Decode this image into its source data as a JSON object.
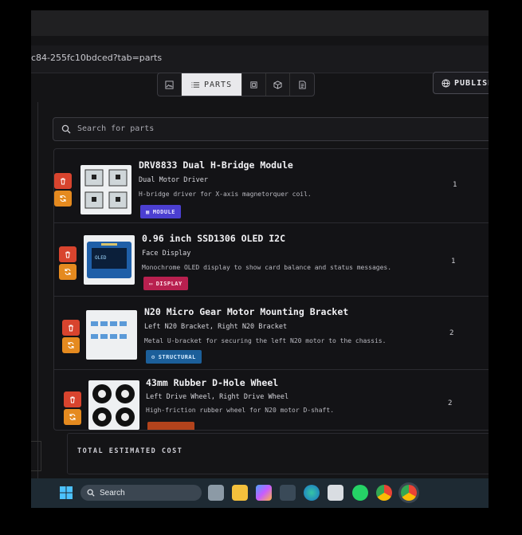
{
  "browser": {
    "url": "c84-255fc10bdced?tab=parts"
  },
  "toolbar": {
    "tabs": [
      {
        "icon": "image-icon",
        "label": ""
      },
      {
        "icon": "list-icon",
        "label": "PARTS"
      },
      {
        "icon": "chip-icon",
        "label": ""
      },
      {
        "icon": "cube-icon",
        "label": ""
      },
      {
        "icon": "document-icon",
        "label": ""
      }
    ],
    "publish_label": "PUBLISH"
  },
  "search": {
    "placeholder": "Search for parts"
  },
  "parts": [
    {
      "name": "DRV8833 Dual H-Bridge Module",
      "role": "Dual Motor Driver",
      "description": "H-bridge driver for X-axis magnetorquer coil.",
      "badge": "MODULE",
      "badge_color": "#4b3fd1",
      "quantity": "1"
    },
    {
      "name": "0.96 inch SSD1306 OLED I2C",
      "role": "Face Display",
      "description": "Monochrome OLED display to show card balance and status messages.",
      "badge": "DISPLAY",
      "badge_color": "#b8204f",
      "quantity": "1"
    },
    {
      "name": "N20 Micro Gear Motor Mounting Bracket",
      "role": "Left N20 Bracket, Right N20 Bracket",
      "description": "Metal U-bracket for securing the left N20 motor to the chassis.",
      "badge": "STRUCTURAL",
      "badge_color": "#1c5f9a",
      "quantity": "2"
    },
    {
      "name": "43mm Rubber D-Hole Wheel",
      "role": "Left Drive Wheel, Right Drive Wheel",
      "description": "High-friction rubber wheel for N20 motor D-shaft.",
      "badge": "",
      "badge_color": "#b2431c",
      "quantity": "2"
    }
  ],
  "total": {
    "label": "TOTAL ESTIMATED COST"
  },
  "taskbar": {
    "search_label": "Search"
  }
}
